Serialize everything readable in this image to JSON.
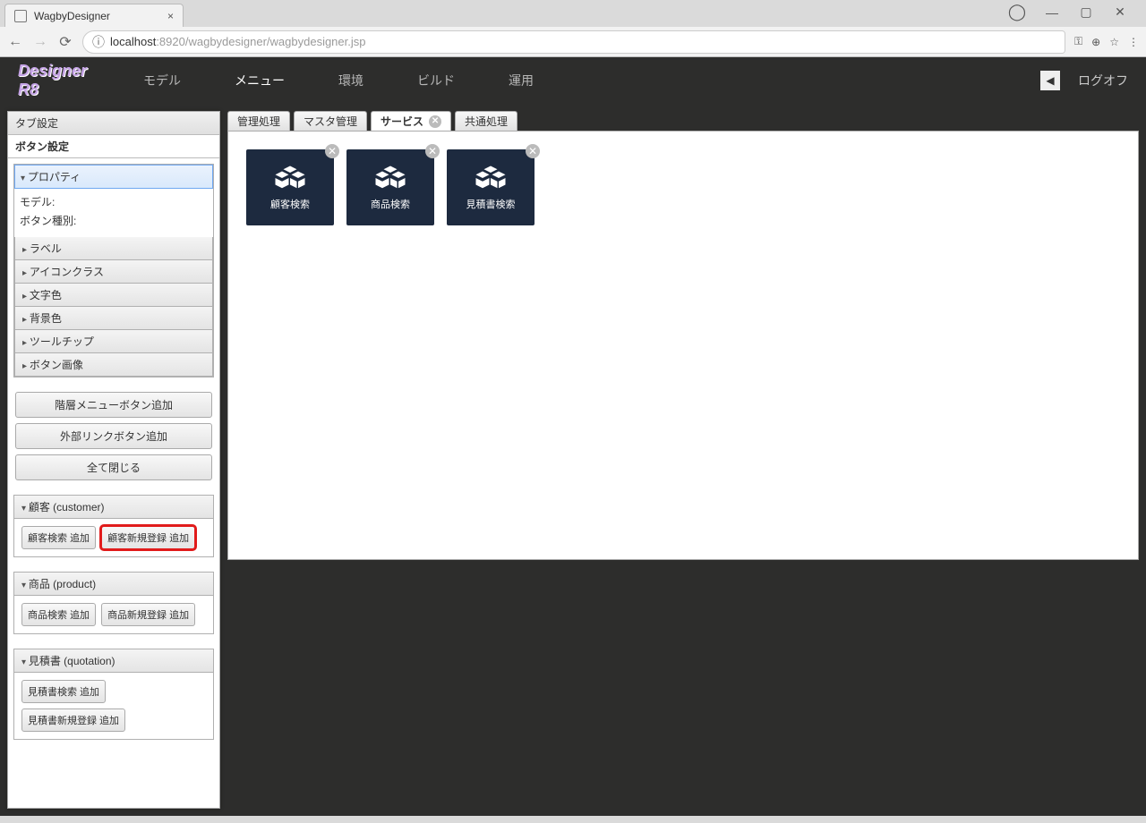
{
  "browser": {
    "tab_title": "WagbyDesigner",
    "url_host": "localhost",
    "url_port": ":8920",
    "url_path": "/wagbydesigner/wagbydesigner.jsp"
  },
  "header": {
    "nav": [
      "モデル",
      "メニュー",
      "環境",
      "ビルド",
      "運用"
    ],
    "active_index": 1,
    "logoff": "ログオフ",
    "product": "Designer R8"
  },
  "left_panel": {
    "tabs": [
      "タブ設定",
      "ボタン設定"
    ],
    "active_tab": 1,
    "property_header": "プロパティ",
    "sub_labels": [
      "モデル:",
      "ボタン種別:"
    ],
    "property_items": [
      "ラベル",
      "アイコンクラス",
      "文字色",
      "背景色",
      "ツールチップ",
      "ボタン画像"
    ],
    "wide_buttons": [
      "階層メニューボタン追加",
      "外部リンクボタン追加",
      "全て閉じる"
    ],
    "models": [
      {
        "title": "顧客 (customer)",
        "buttons": [
          "顧客検索 追加",
          "顧客新規登録 追加"
        ],
        "highlight_index": 1
      },
      {
        "title": "商品 (product)",
        "buttons": [
          "商品検索 追加",
          "商品新規登録 追加"
        ]
      },
      {
        "title": "見積書 (quotation)",
        "buttons": [
          "見積書検索 追加",
          "見積書新規登録 追加"
        ],
        "stacked": true
      }
    ]
  },
  "content": {
    "tabs": [
      "管理処理",
      "マスタ管理",
      "サービス",
      "共通処理"
    ],
    "active_index": 2,
    "closable_index": 2,
    "tiles": [
      "顧客検索",
      "商品検索",
      "見積書検索"
    ]
  }
}
